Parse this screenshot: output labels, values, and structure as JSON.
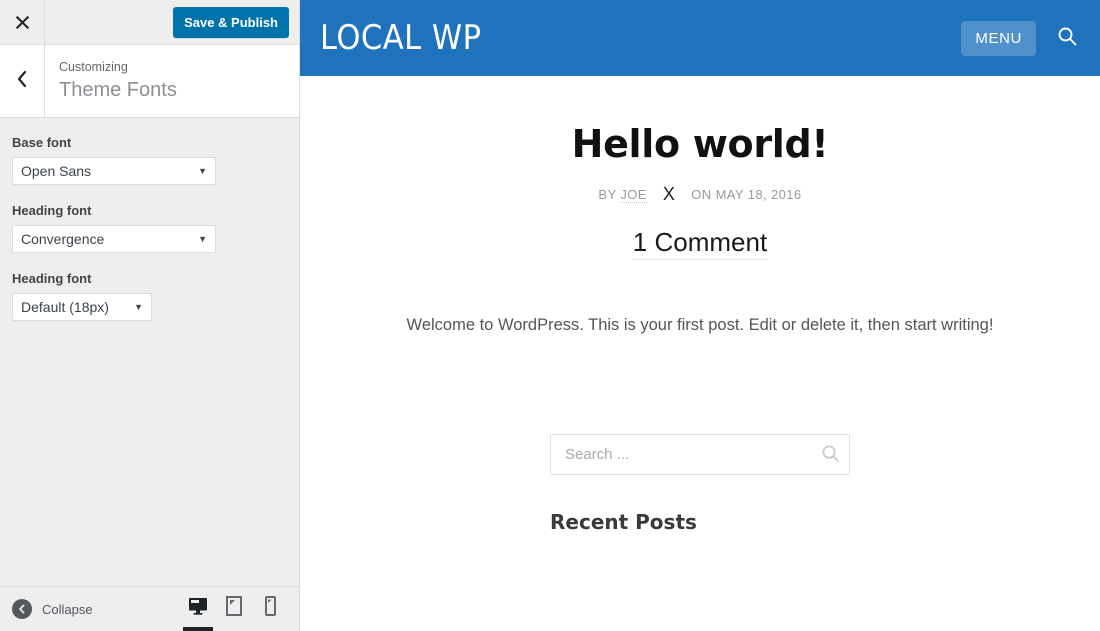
{
  "customizer": {
    "close_label": "×",
    "close_icon": "close-icon",
    "save_button": "Save & Publish",
    "back_icon": "chevron-left-icon",
    "kicker": "Customizing",
    "panel_title": "Theme Fonts",
    "controls": [
      {
        "label": "Base font",
        "value": "Open Sans",
        "arrow": "▼",
        "width": "wide"
      },
      {
        "label": "Heading font",
        "value": "Convergence",
        "arrow": "▼",
        "width": "wide"
      },
      {
        "label": "Heading font",
        "value": "Default (18px)",
        "arrow": "▼",
        "width": "narrow"
      }
    ],
    "footer": {
      "collapse_label": "Collapse",
      "collapse_icon": "collapse-arrow-icon",
      "devices": [
        {
          "name": "desktop",
          "icon": "desktop-icon",
          "active": true
        },
        {
          "name": "tablet",
          "icon": "tablet-icon",
          "active": false
        },
        {
          "name": "mobile",
          "icon": "mobile-icon",
          "active": false
        }
      ]
    },
    "colors": {
      "save_button_bg": "#0073aa",
      "sidebar_bg": "#eeeeee",
      "active_device_underline": "#1d2327"
    }
  },
  "preview": {
    "site_title": "LOCAL WP",
    "menu_button": "MENU",
    "search_toggle_icon": "search-icon",
    "post": {
      "title": "Hello world!",
      "meta_by": "BY",
      "meta_author": "JOE",
      "meta_separator": "X",
      "meta_on": "ON MAY 18, 2016",
      "comment_count": "1 Comment",
      "body": "Welcome to WordPress. This is your first post. Edit or delete it, then start writing!"
    },
    "widgets": {
      "search_placeholder": "Search ...",
      "search_value": "",
      "search_icon": "search-icon",
      "recent_posts_title": "Recent Posts"
    },
    "colors": {
      "header_bg": "#1f73bd",
      "menu_button_bg": "rgba(255,255,255,0.22)"
    }
  }
}
